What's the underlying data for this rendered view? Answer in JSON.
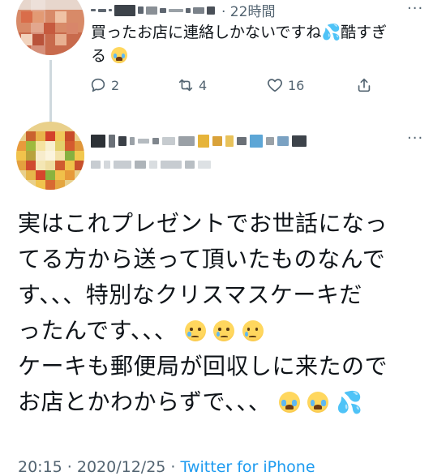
{
  "reply": {
    "time": "· 22時間",
    "more_label": "···",
    "text": "買ったお店に連絡しかないですね",
    "text_after_sweat": "酷すぎ",
    "text_line2": "る",
    "sweat_emoji": "💦",
    "actions": {
      "reply_icon": "comment-icon",
      "reply_count": "2",
      "retweet_icon": "retweet-icon",
      "retweet_count": "4",
      "like_icon": "heart-icon",
      "like_count": "16",
      "share_icon": "share-icon"
    }
  },
  "main": {
    "more_label": "···",
    "lines": [
      "実はこれプレゼントでお世話になっ",
      "てる方から送って頂いたものなんで",
      "す、、、特別なクリスマスケーキだ",
      "ったんです、、、",
      "ケーキも郵便局が回収しに来たので",
      "お店とかわからずで、、、"
    ],
    "sweat_emoji": "💦",
    "timestamp": "20:15 · 2020/12/25 · ",
    "source": "Twitter for iPhone"
  },
  "colors": {
    "text": "#0f1419",
    "secondary": "#536471",
    "link": "#1d9bf0",
    "thread_line": "#cfd9de"
  }
}
